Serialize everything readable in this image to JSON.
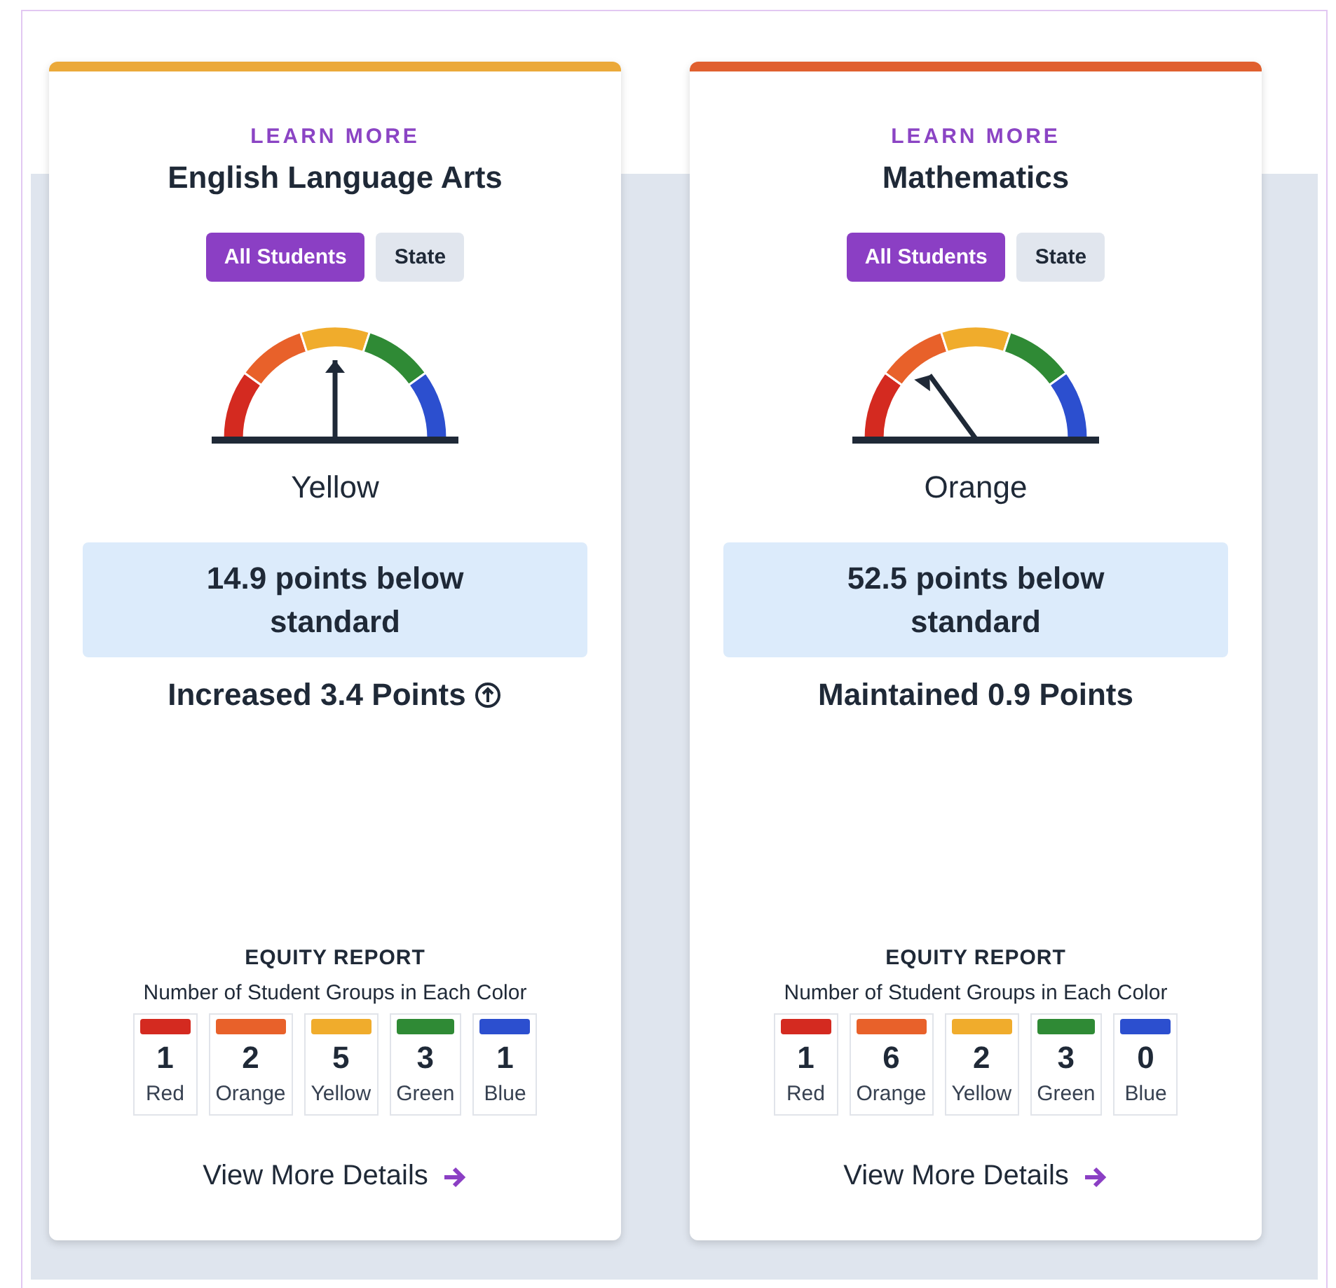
{
  "cards": [
    {
      "color": "#eba93a",
      "link": "LEARN MORE",
      "title": "English Language Arts",
      "filters": [
        {
          "label": "All Students",
          "selected": true
        },
        {
          "label": "State",
          "selected": false
        }
      ],
      "level": 0.5,
      "status_color": "Yellow",
      "status": "14.9 points below standard",
      "change": "Increased 3.4 Points",
      "increased": true,
      "equity_title": "EQUITY REPORT",
      "equity_subtitle": "Number of Student Groups in Each Color",
      "groups": [
        {
          "color": "#d42a20",
          "count": "1",
          "label": "Red"
        },
        {
          "color": "#e8612a",
          "count": "2",
          "label": "Orange"
        },
        {
          "color": "#f0ac2c",
          "count": "5",
          "label": "Yellow"
        },
        {
          "color": "#2f8a35",
          "count": "3",
          "label": "Green"
        },
        {
          "color": "#2c4fcf",
          "count": "1",
          "label": "Blue"
        }
      ],
      "details": "View More Details"
    },
    {
      "color": "#e0602f",
      "link": "LEARN MORE",
      "title": "Mathematics",
      "filters": [
        {
          "label": "All Students",
          "selected": true
        },
        {
          "label": "State",
          "selected": false
        }
      ],
      "level": 0.3,
      "status_color": "Orange",
      "status": "52.5 points below standard",
      "change": "Maintained 0.9 Points",
      "increased": false,
      "equity_title": "EQUITY REPORT",
      "equity_subtitle": "Number of Student Groups in Each Color",
      "groups": [
        {
          "color": "#d42a20",
          "count": "1",
          "label": "Red"
        },
        {
          "color": "#e8612a",
          "count": "6",
          "label": "Orange"
        },
        {
          "color": "#f0ac2c",
          "count": "2",
          "label": "Yellow"
        },
        {
          "color": "#2f8a35",
          "count": "3",
          "label": "Green"
        },
        {
          "color": "#2c4fcf",
          "count": "0",
          "label": "Blue"
        }
      ],
      "details": "View More Details"
    }
  ]
}
